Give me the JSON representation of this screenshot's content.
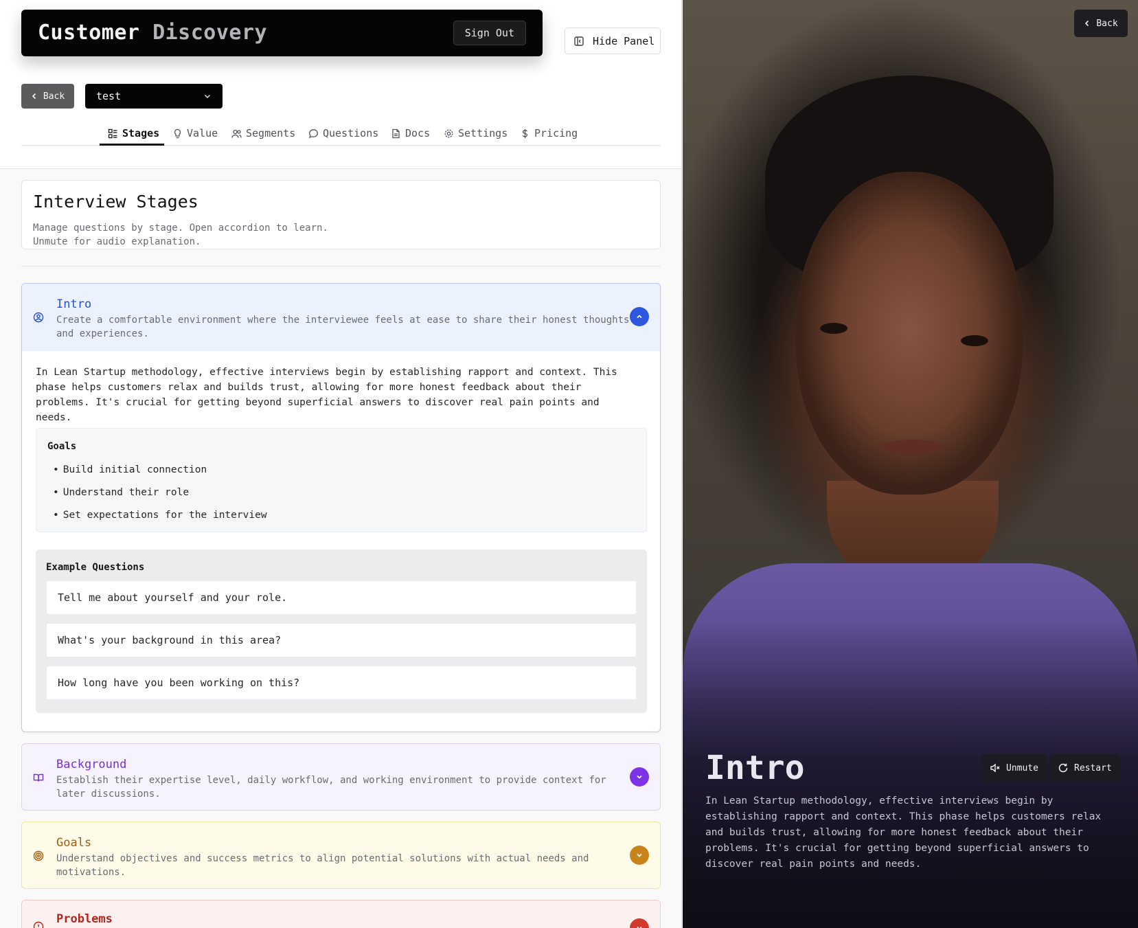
{
  "header": {
    "title_word1": "Customer",
    "title_word2": "Discovery",
    "signout_label": "Sign Out",
    "hide_panel_label": "Hide Panel"
  },
  "nav": {
    "back_label": "Back",
    "project_select_value": "test"
  },
  "tabs": [
    {
      "label": "Stages",
      "icon": "stages-icon",
      "active": true
    },
    {
      "label": "Value",
      "icon": "lightbulb-icon",
      "active": false
    },
    {
      "label": "Segments",
      "icon": "users-icon",
      "active": false
    },
    {
      "label": "Questions",
      "icon": "chat-bubble-icon",
      "active": false
    },
    {
      "label": "Docs",
      "icon": "document-icon",
      "active": false
    },
    {
      "label": "Settings",
      "icon": "gear-icon",
      "active": false
    },
    {
      "label": "Pricing",
      "icon": "dollar-icon",
      "active": false
    }
  ],
  "stages_card": {
    "title": "Interview Stages",
    "description": "Manage questions by stage. Open accordion to learn.\nUnmute for audio explanation."
  },
  "stages": {
    "intro": {
      "title": "Intro",
      "subtitle": "Create a comfortable environment where the interviewee feels at ease to share their honest thoughts and experiences.",
      "body": "In Lean Startup methodology, effective interviews begin by establishing rapport and context. This phase helps customers relax and builds trust, allowing for more honest feedback about their problems. It's crucial for getting beyond superficial answers to discover real pain points and needs.",
      "goals_heading": "Goals",
      "goals": [
        "Build initial connection",
        "Understand their role",
        "Set expectations for the interview"
      ],
      "examples_heading": "Example Questions",
      "examples": [
        "Tell me about yourself and your role.",
        "What's your background in this area?",
        "How long have you been working on this?"
      ],
      "color": "#2450d6",
      "icon": "user-circle-icon"
    },
    "background": {
      "title": "Background",
      "subtitle": "Establish their expertise level, daily workflow, and working environment to provide context for later discussions.",
      "color": "#7a2fd6",
      "icon": "book-open-icon"
    },
    "goals": {
      "title": "Goals",
      "subtitle": "Understand objectives and success metrics to align potential solutions with actual needs and motivations.",
      "color": "#a05f0c",
      "icon": "target-icon"
    },
    "problems": {
      "title": "Problems",
      "color": "#b3261e",
      "icon": "alert-circle-icon"
    }
  },
  "video_panel": {
    "back_label": "Back",
    "stage_title": "Intro",
    "unmute_label": "Unmute",
    "restart_label": "Restart",
    "caption": "In Lean Startup methodology, effective interviews begin by establishing rapport and context. This phase helps customers relax and builds trust, allowing for more honest feedback about their problems. It's crucial for getting beyond superficial answers to discover real pain points and needs."
  }
}
